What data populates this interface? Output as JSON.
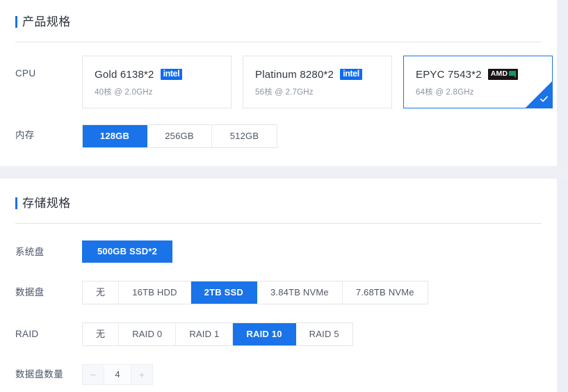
{
  "sections": [
    {
      "id": "product-spec",
      "title": "产品规格",
      "rows": [
        {
          "id": "cpu",
          "label": "CPU",
          "type": "cards",
          "options": [
            {
              "name": "Gold 6138*2",
              "sub": "40核 @ 2.0GHz",
              "brand": "intel",
              "brand_label": "intel",
              "selected": false
            },
            {
              "name": "Platinum 8280*2",
              "sub": "56核 @ 2.7GHz",
              "brand": "intel",
              "brand_label": "intel",
              "selected": false
            },
            {
              "name": "EPYC 7543*2",
              "sub": "64核 @ 2.8GHz",
              "brand": "amd",
              "brand_label": "AMD",
              "selected": true
            }
          ]
        },
        {
          "id": "memory",
          "label": "内存",
          "type": "segmented",
          "options": [
            {
              "label": "128GB",
              "selected": true
            },
            {
              "label": "256GB",
              "selected": false
            },
            {
              "label": "512GB",
              "selected": false
            }
          ]
        }
      ]
    },
    {
      "id": "storage-spec",
      "title": "存储规格",
      "rows": [
        {
          "id": "system-disk",
          "label": "系统盘",
          "type": "solid",
          "options": [
            {
              "label": "500GB SSD*2",
              "selected": true
            }
          ]
        },
        {
          "id": "data-disk",
          "label": "数据盘",
          "type": "segmented",
          "options": [
            {
              "label": "无",
              "selected": false
            },
            {
              "label": "16TB HDD",
              "selected": false
            },
            {
              "label": "2TB SSD",
              "selected": true
            },
            {
              "label": "3.84TB NVMe",
              "selected": false
            },
            {
              "label": "7.68TB NVMe",
              "selected": false
            }
          ]
        },
        {
          "id": "raid",
          "label": "RAID",
          "type": "segmented",
          "options": [
            {
              "label": "无",
              "selected": false
            },
            {
              "label": "RAID 0",
              "selected": false
            },
            {
              "label": "RAID 1",
              "selected": false
            },
            {
              "label": "RAID 10",
              "selected": true
            },
            {
              "label": "RAID 5",
              "selected": false
            }
          ]
        },
        {
          "id": "data-disk-count",
          "label": "数据盘数量",
          "type": "stepper",
          "decrement_label": "−",
          "increment_label": "+",
          "value": "4"
        }
      ]
    }
  ],
  "colors": {
    "accent": "#1a73e8",
    "panel_bg": "#ffffff",
    "page_bg": "#eceff5",
    "border": "#e3e5e9",
    "label_text": "#4a5568",
    "title_text": "#2c3138",
    "intel_blue": "#0f6cf0",
    "amd_black": "#1b1417",
    "amd_green": "#0f9b5a"
  }
}
